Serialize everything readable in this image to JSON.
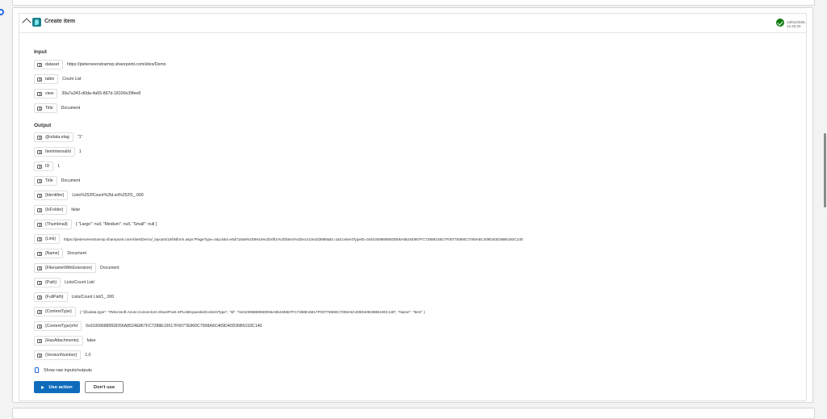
{
  "header": {
    "title": "Create item",
    "timestamp": "13/01/2026, 12:40:20"
  },
  "input": {
    "section_title": "Input",
    "params": [
      {
        "key": "dataset",
        "value": "https://pieterveenstramvp.sharepoint.com/sites/Demo"
      },
      {
        "key": "table",
        "value": "Count List"
      },
      {
        "key": "view",
        "value": "39a7a343-d0da-4a55-867d-18100e39fee8"
      },
      {
        "key": "Title",
        "value": "Document"
      }
    ]
  },
  "output": {
    "section_title": "Output",
    "params": [
      {
        "key": "@odata.etag",
        "value": "\"1\""
      },
      {
        "key": "ItemInternalId",
        "value": "1"
      },
      {
        "key": "ID",
        "value": "1"
      },
      {
        "key": "Title",
        "value": "Document"
      },
      {
        "key": "{Identifier}",
        "value": "Lists%252fCount%2bList%252f1_.000"
      },
      {
        "key": "{IsFolder}",
        "value": "false"
      },
      {
        "key": "{Thumbnail}",
        "value": "{ \"Large\": null, \"Medium\": null, \"Small\": null }"
      },
      {
        "key": "{Link}",
        "value": "https://pieterveenstramvp.sharepoint.com/sites/Demo/_layouts/15/listform.aspx?PageType=4&ListId=e5d716a8%2D9e2a%2D4fb1%2Db5e2%2De1413e2d3898&ID=1&ContentTypeID=0x0100968895DD56A8524E867FC7288E15517F0077E860C7008A6C409D40D36B6193C140"
      },
      {
        "key": "{Name}",
        "value": "Document"
      },
      {
        "key": "{FilenameWithExtension}",
        "value": "Document"
      },
      {
        "key": "{Path}",
        "value": "Lists/Count List/"
      },
      {
        "key": "{FullPath}",
        "value": "Lists/Count List/1_.000"
      },
      {
        "key": "{ContentType}",
        "value": "{ \"@odata.type\": \"#Microsoft.Azure.Connectors.SharePoint.SPListExpandedContentType\", \"Id\": \"0x0100968895DD56A8524E867FC7288E15517F0077E860C7008A6C409D40D36B6193C140\", \"Name\": \"Item\" }"
      },
      {
        "key": "{ContentType}#Id",
        "value": "0x0100968895DD56A8524E867FC7288E15517F0077E860C7008A6C409D40D36B6193C140"
      },
      {
        "key": "{HasAttachments}",
        "value": "false"
      },
      {
        "key": "{VersionNumber}",
        "value": "1.0"
      }
    ]
  },
  "raw_link_label": "Show raw inputs/outputs",
  "buttons": {
    "use_action": "Use action",
    "dont_use": "Don't use"
  },
  "colors": {
    "primary": "#0f6cbd",
    "success": "#107c10",
    "accent": "#2266e3"
  },
  "icons": {
    "chevron": "chevron-up-icon",
    "action": "sharepoint-icon",
    "status": "checkmark-circle-icon",
    "param": "table-field-icon",
    "raw": "document-icon",
    "play": "play-icon"
  }
}
